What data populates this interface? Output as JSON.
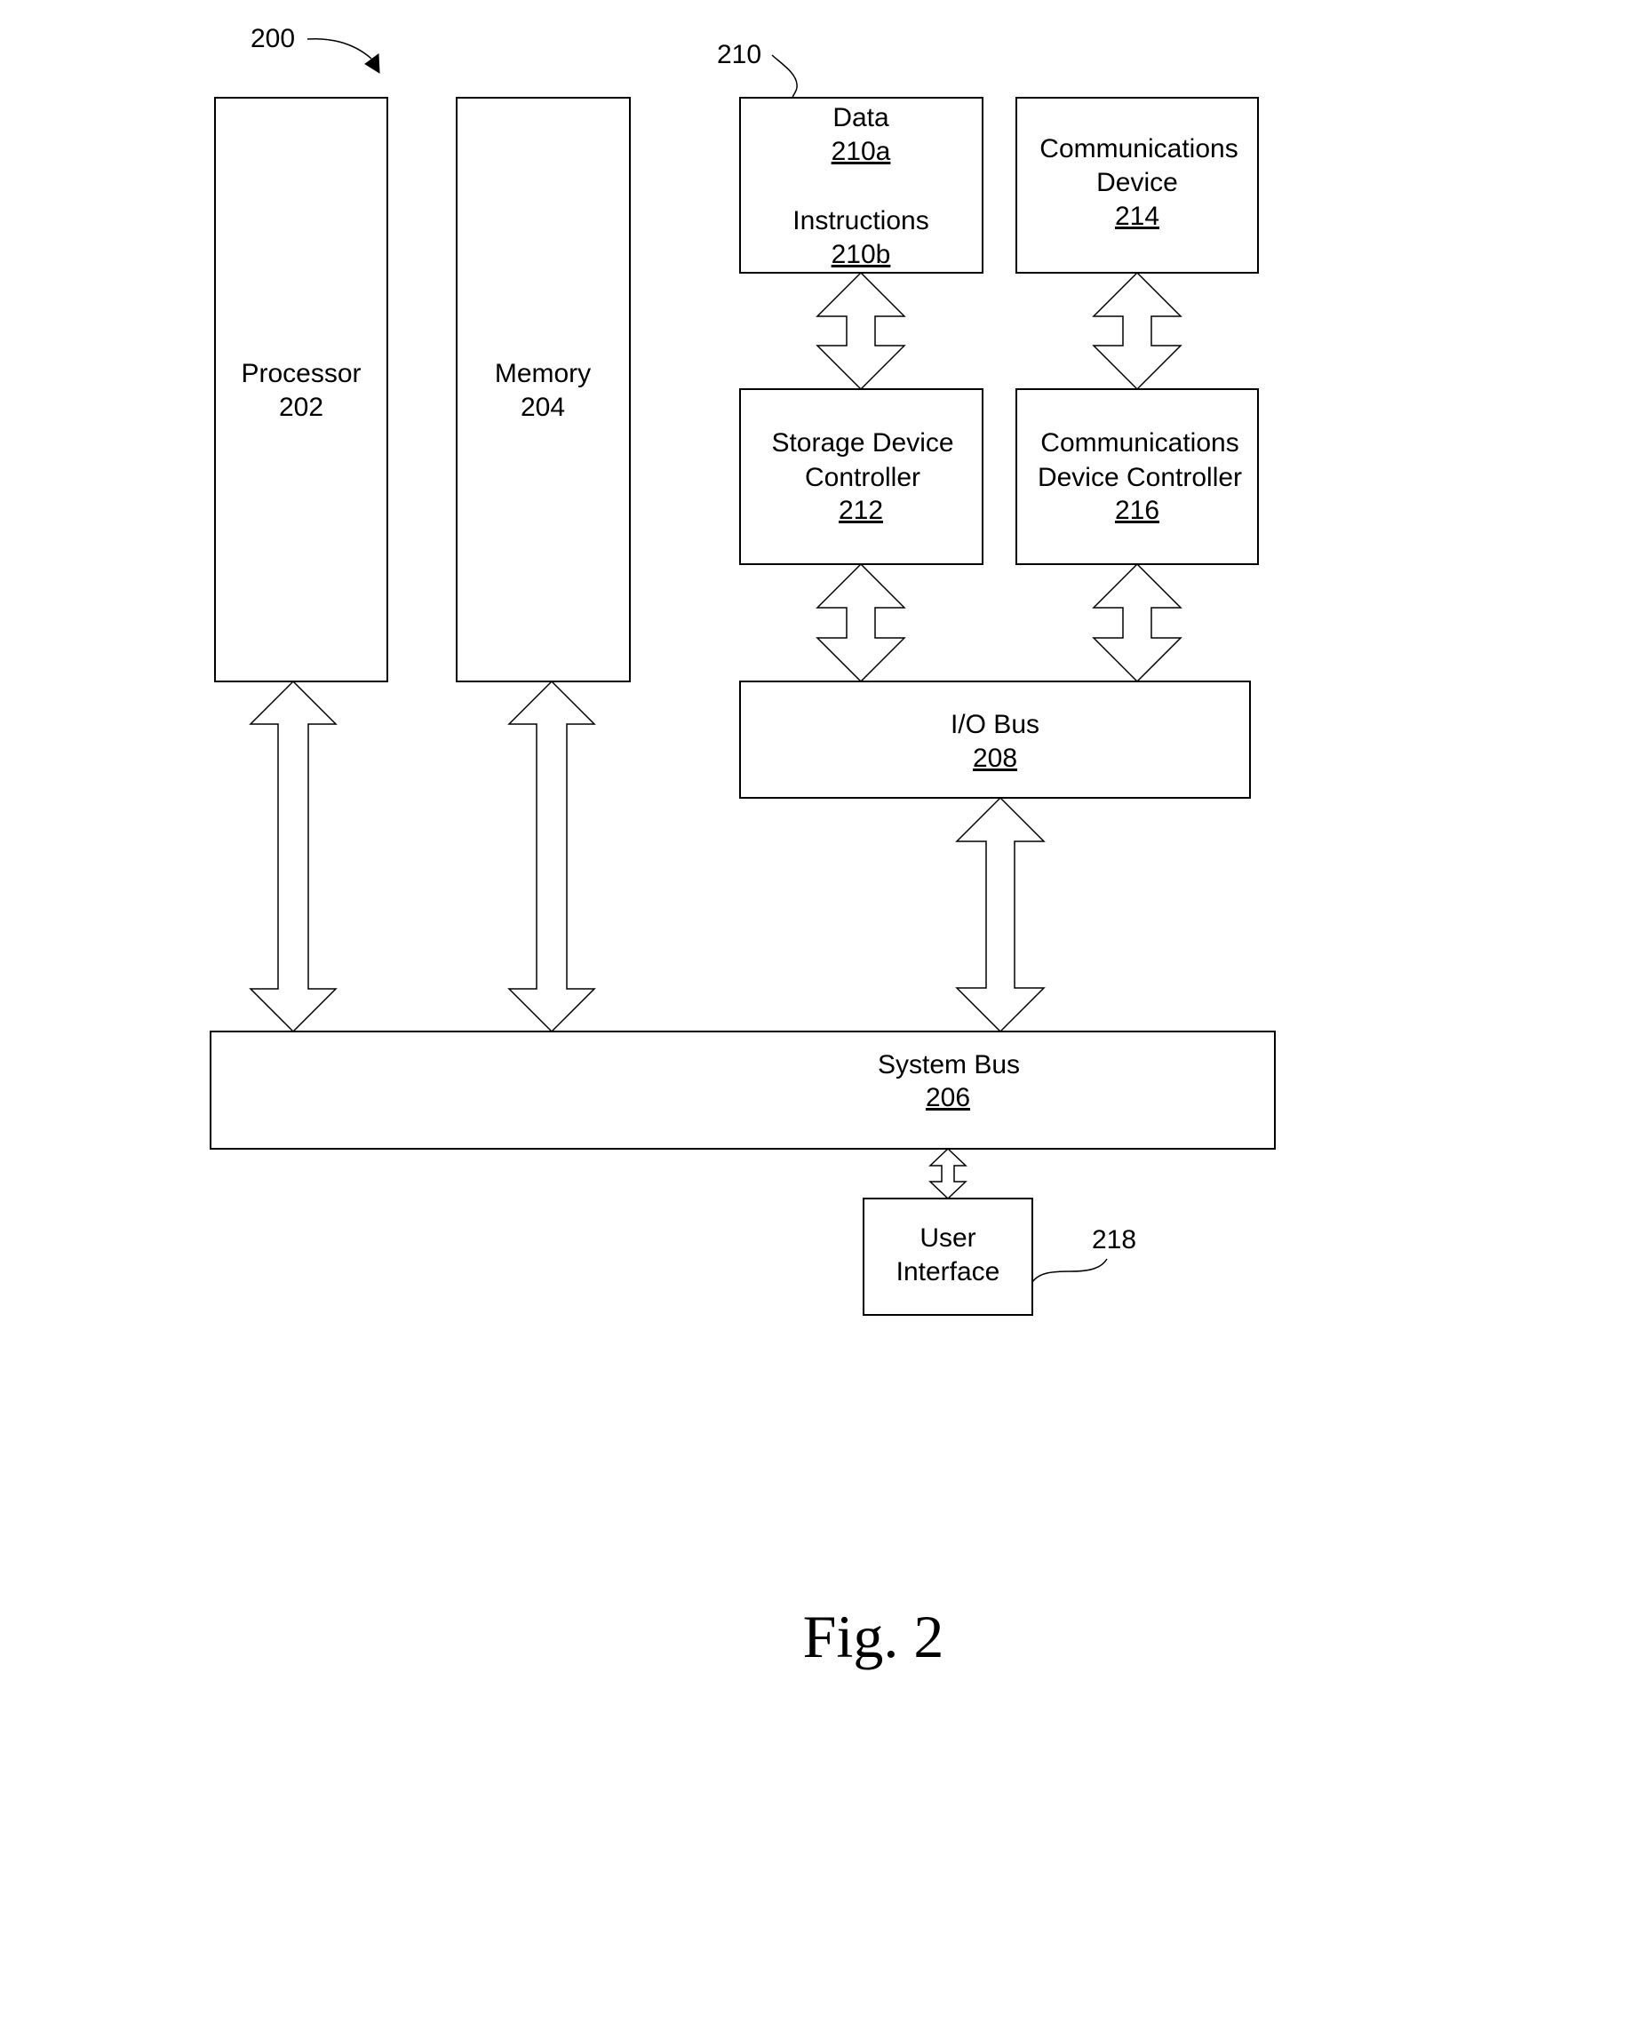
{
  "figure": {
    "reference": "200",
    "caption": "Fig. 2"
  },
  "callouts": {
    "group_210": "210",
    "user_interface_218": "218"
  },
  "blocks": {
    "processor": {
      "label": "Processor",
      "ref": "202"
    },
    "memory": {
      "label": "Memory",
      "ref": "204"
    },
    "storage": {
      "data_label": "Data",
      "data_ref": "210a",
      "instructions_label": "Instructions",
      "instructions_ref": "210b"
    },
    "communications_device": {
      "line1": "Communications",
      "line2": "Device",
      "ref": "214"
    },
    "storage_device_controller": {
      "line1": "Storage Device",
      "line2": "Controller",
      "ref": "212"
    },
    "communications_device_controller": {
      "line1": "Communications",
      "line2": "Device Controller",
      "ref": "216"
    },
    "io_bus": {
      "label": "I/O Bus",
      "ref": "208"
    },
    "system_bus": {
      "label": "System Bus",
      "ref": "206"
    },
    "user_interface": {
      "line1": "User",
      "line2": "Interface"
    }
  },
  "connections": [
    {
      "from": "processor",
      "to": "system_bus",
      "type": "bidirectional"
    },
    {
      "from": "memory",
      "to": "system_bus",
      "type": "bidirectional"
    },
    {
      "from": "storage",
      "to": "storage_device_controller",
      "type": "bidirectional"
    },
    {
      "from": "communications_device",
      "to": "communications_device_controller",
      "type": "bidirectional"
    },
    {
      "from": "storage_device_controller",
      "to": "io_bus",
      "type": "bidirectional"
    },
    {
      "from": "communications_device_controller",
      "to": "io_bus",
      "type": "bidirectional"
    },
    {
      "from": "io_bus",
      "to": "system_bus",
      "type": "bidirectional"
    },
    {
      "from": "system_bus",
      "to": "user_interface",
      "type": "bidirectional"
    }
  ]
}
